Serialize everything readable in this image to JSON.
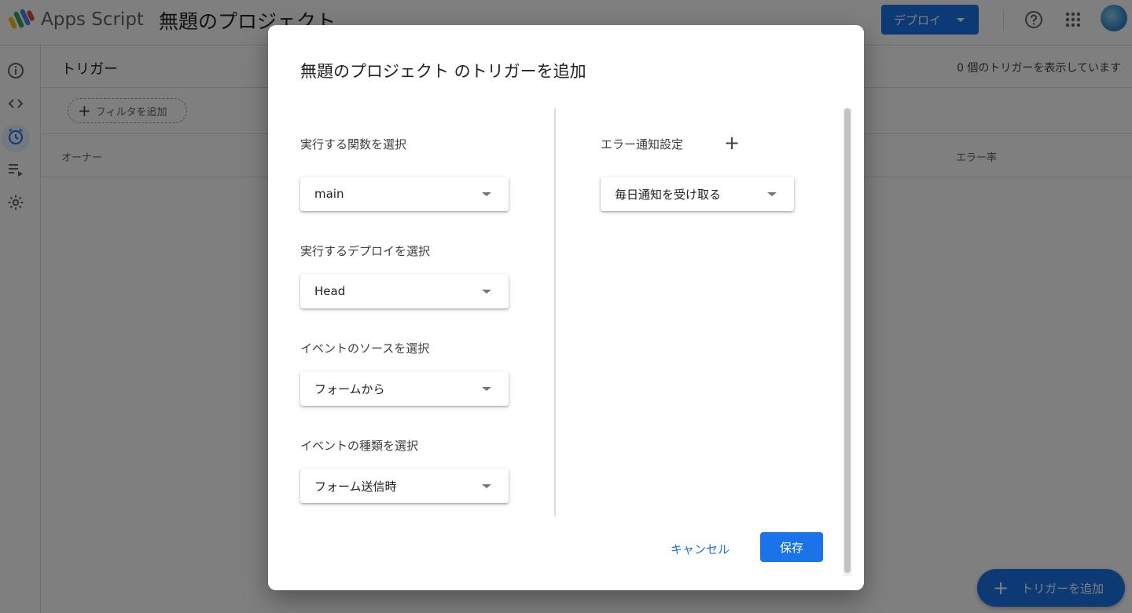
{
  "app": {
    "name": "Apps Script",
    "project_title": "無題のプロジェクト"
  },
  "header": {
    "deploy_label": "デプロイ"
  },
  "page": {
    "title": "トリガー",
    "trigger_count_text": "0 個のトリガーを表示しています",
    "filter_label": "フィルタを追加",
    "columns": {
      "owner": "オーナー",
      "error_rate": "エラー率"
    },
    "fab_label": "トリガーを追加"
  },
  "dialog": {
    "title": "無題のプロジェクト のトリガーを追加",
    "function_label": "実行する関数を選択",
    "function_value": "main",
    "deploy_label": "実行するデプロイを選択",
    "deploy_value": "Head",
    "source_label": "イベントのソースを選択",
    "source_value": "フォームから",
    "type_label": "イベントの種類を選択",
    "type_value": "フォーム送信時",
    "error_label": "エラー通知設定",
    "error_value": "毎日通知を受け取る",
    "cancel_label": "キャンセル",
    "save_label": "保存"
  },
  "colors": {
    "accent": "#1a73e8",
    "scrim": "rgba(0,0,0,0.5)"
  },
  "icons": [
    "apps-script-logo-icon",
    "help-icon",
    "apps-grid-icon",
    "info-icon",
    "code-icon",
    "alarm-clock-icon",
    "executions-icon",
    "settings-icon",
    "add-icon",
    "dropdown-arrow-icon"
  ]
}
